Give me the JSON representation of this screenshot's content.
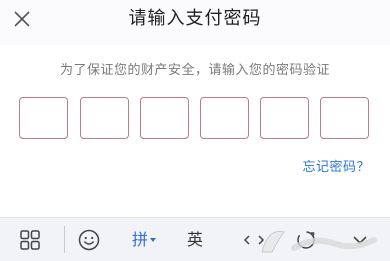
{
  "header": {
    "title": "请输入支付密码",
    "close_icon": "close-icon"
  },
  "hint": "为了保证您的财产安全，请输入您的密码验证",
  "pin_boxes": [
    "",
    "",
    "",
    "",
    "",
    ""
  ],
  "forgot_link": "忘记密码？",
  "keyboard_toolbar": {
    "items": [
      {
        "icon": "grid-menu-icon"
      },
      {
        "icon": "emoji-icon"
      },
      {
        "label": "拼"
      },
      {
        "label": "英"
      },
      {
        "icon": "cursor-move-icon"
      },
      {
        "icon": "voice-icon"
      },
      {
        "icon": "collapse-keyboard-icon"
      }
    ]
  },
  "colors": {
    "pin_border": "#c17a86",
    "link": "#2a78d4",
    "pinyin_active": "#2f6fd3"
  }
}
